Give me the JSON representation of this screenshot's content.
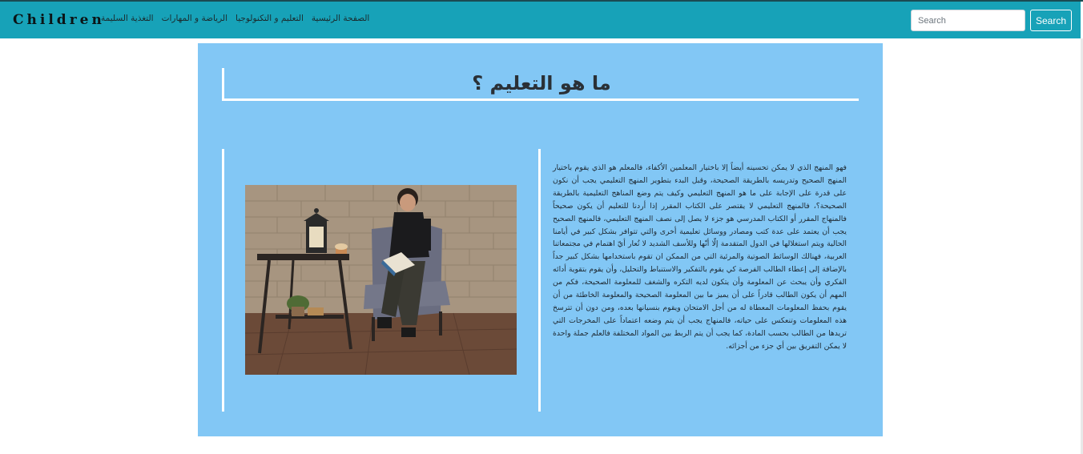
{
  "navbar": {
    "brand": "Children",
    "links": [
      "الصفحة الرئيسية",
      "التعليم و التكنولوجيا",
      "الرياضة و المهارات",
      "التغذية السليمة"
    ],
    "search_placeholder": "Search",
    "search_button": "Search"
  },
  "main": {
    "title": "ما هو التعليم ؟",
    "body": "فهو المنهج الذي لا يمكن تحسينه أيضاً إلا باختيار المعلمين الأكفاء، فالمعلم هو الذي يقوم باختيار المنهج الصحيح وتدريسه بالطريقة الصحيحة، وقبل البدء بتطوير المنهج التعليمي يجب أن نكون على قدرة على الإجابة على ما هو المنهج التعليمي وكيف يتم وضع المناهج التعليمية بالطريقة الصحيحة؟، فالمنهج التعليمي لا يقتصر على الكتاب المقرر إذا أردنا للتعليم أن يكون صحيحاً فالمنهاج المقرر أو الكتاب المدرسي هو جزء لا يصل إلى نصف المنهج التعليمي، فالمنهج الصحيح يجب أن يعتمد على عدة كتب ومصادر ووسائل تعليمية أخرى والتي تتوافر بشكل كبير في أيامنا الحالية ويتم استغلالها في الدول المتقدمة إلّا أنّها وللأسف الشديد لا تُعار أيّ اهتمام في مجتمعاتنا العربية، فهنالك الوسائط الصوتية والمرئية التي من الممكن ان تقوم باستخدامها بشكل كبير جداً بالإضافة إلى إعطاء الطالب الفرصة كي يقوم بالتفكير والاستنباط والتحليل، وأن يقوم بتقوية أدائه الفكري وأن يبحث عن المعلومة وأن يتكون لديه التكره والشغف للمعلومة الصحيحة، فكم من المهم أن يكون الطالب قادراً على أن يميز ما بين المعلومة الصحيحة والمعلومة الخاطئة من أن يقوم بحفظ المعلومات المعطاة له من أجل الامتحان ويقوم بنسيانها بعده، ومن دون أن تترسخ هذه المعلومات وتنعكس على حياته، فالمنهاج يجب أن يتم وضعه اعتماداً على المخرجات التي تريدها من الطالب بحسب المادة، كما يجب أن يتم الربط بين المواد المختلفة فالعلم جملة واحدة لا يمكن التفريق بين أي جزء من أجزائه."
  },
  "colors": {
    "navbar": "#17a2b8",
    "panel": "#82c7f5",
    "text": "#1f2a33"
  }
}
